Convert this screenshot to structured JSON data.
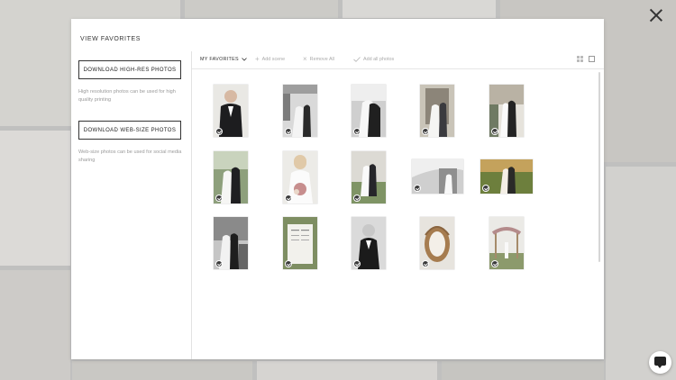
{
  "modal": {
    "title": "VIEW FAVORITES"
  },
  "download": {
    "highres_label": "DOWNLOAD HIGH-RES PHOTOS",
    "highres_note": "High resolution photos can be used for high quality printing",
    "web_label": "DOWNLOAD WEB-SIZE PHOTOS",
    "web_note": "Web-size photos can be used for social media sharing"
  },
  "toolbar": {
    "collection": "MY FAVORITES",
    "add_scene": "Add scene",
    "remove_all": "Remove All",
    "add_all": "Add all photos"
  },
  "photos": [
    {
      "subject": "groom-portrait",
      "style": "color",
      "selected": true
    },
    {
      "subject": "couple-porch",
      "style": "bw",
      "selected": true
    },
    {
      "subject": "couple-embrace",
      "style": "bw",
      "selected": true
    },
    {
      "subject": "couple-doorway",
      "style": "color",
      "selected": true
    },
    {
      "subject": "couple-kiss-porch",
      "style": "color",
      "selected": true
    },
    {
      "subject": "couple-garden",
      "style": "color",
      "selected": true
    },
    {
      "subject": "bride-bouquet",
      "style": "color",
      "selected": true
    },
    {
      "subject": "couple-lawn",
      "style": "color",
      "selected": true
    },
    {
      "subject": "detail-wide",
      "style": "bw",
      "selected": true
    },
    {
      "subject": "couple-field-sunset",
      "style": "color",
      "selected": true
    },
    {
      "subject": "couple-walking",
      "style": "bw",
      "selected": true
    },
    {
      "subject": "invitation-suite",
      "style": "color",
      "selected": true
    },
    {
      "subject": "ring-bearer",
      "style": "bw",
      "selected": true
    },
    {
      "subject": "basket-detail",
      "style": "color",
      "selected": true
    },
    {
      "subject": "floral-arch",
      "style": "color",
      "selected": true
    }
  ],
  "icons": {
    "close": "close-icon",
    "chevron": "chevron-down-icon",
    "add": "plus-icon",
    "remove": "x-icon",
    "add_all": "checkmark-icon",
    "grid_view": "grid-view-icon",
    "single_view": "single-view-icon",
    "selected": "check-circle-icon",
    "chat": "chat-icon"
  }
}
